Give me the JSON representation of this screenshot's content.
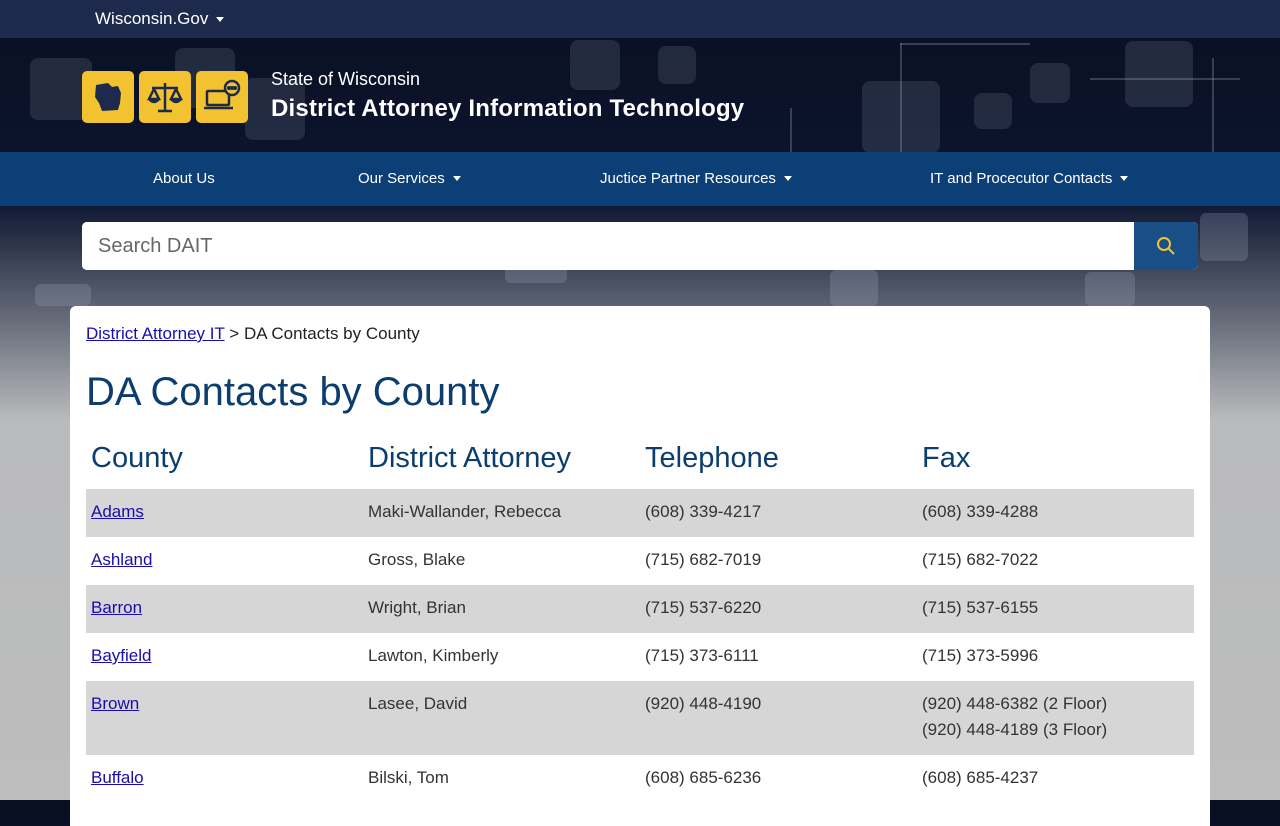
{
  "topbar": {
    "gov_label": "Wisconsin.Gov"
  },
  "header": {
    "state": "State of Wisconsin",
    "title": "District Attorney Information Technology",
    "icons": [
      "wisconsin-map-icon",
      "scales-of-justice-icon",
      "laptop-chat-icon"
    ],
    "accent": "#f2c230"
  },
  "nav": {
    "items": [
      {
        "label": "About Us",
        "dropdown": false
      },
      {
        "label": "Our Services",
        "dropdown": true
      },
      {
        "label": "Juctice Partner Resources",
        "dropdown": true
      },
      {
        "label": "IT and Procecutor Contacts",
        "dropdown": true
      }
    ],
    "background": "#0d3f77"
  },
  "search": {
    "placeholder": "Search DAIT"
  },
  "breadcrumb": {
    "link": "District Attorney IT",
    "separator": ">",
    "current": "DA Contacts by County"
  },
  "page": {
    "title": "DA Contacts by County"
  },
  "table": {
    "headers": [
      "County",
      "District Attorney",
      "Telephone",
      "Fax"
    ],
    "rows": [
      {
        "county": "Adams",
        "da": "Maki-Wallander, Rebecca",
        "phone": "(608) 339-4217",
        "fax": [
          "(608) 339-4288"
        ]
      },
      {
        "county": "Ashland",
        "da": "Gross, Blake",
        "phone": "(715) 682-7019",
        "fax": [
          "(715) 682-7022"
        ]
      },
      {
        "county": "Barron",
        "da": "Wright, Brian",
        "phone": "(715) 537-6220",
        "fax": [
          "(715) 537-6155"
        ]
      },
      {
        "county": "Bayfield",
        "da": "Lawton, Kimberly",
        "phone": "(715) 373-6111",
        "fax": [
          "(715) 373-5996"
        ]
      },
      {
        "county": "Brown",
        "da": "Lasee, David",
        "phone": "(920) 448-4190",
        "fax": [
          "(920) 448-6382 (2 Floor)",
          "(920) 448-4189 (3 Floor)"
        ]
      },
      {
        "county": "Buffalo",
        "da": "Bilski, Tom",
        "phone": "(608) 685-6236",
        "fax": [
          "(608) 685-4237"
        ]
      }
    ]
  }
}
